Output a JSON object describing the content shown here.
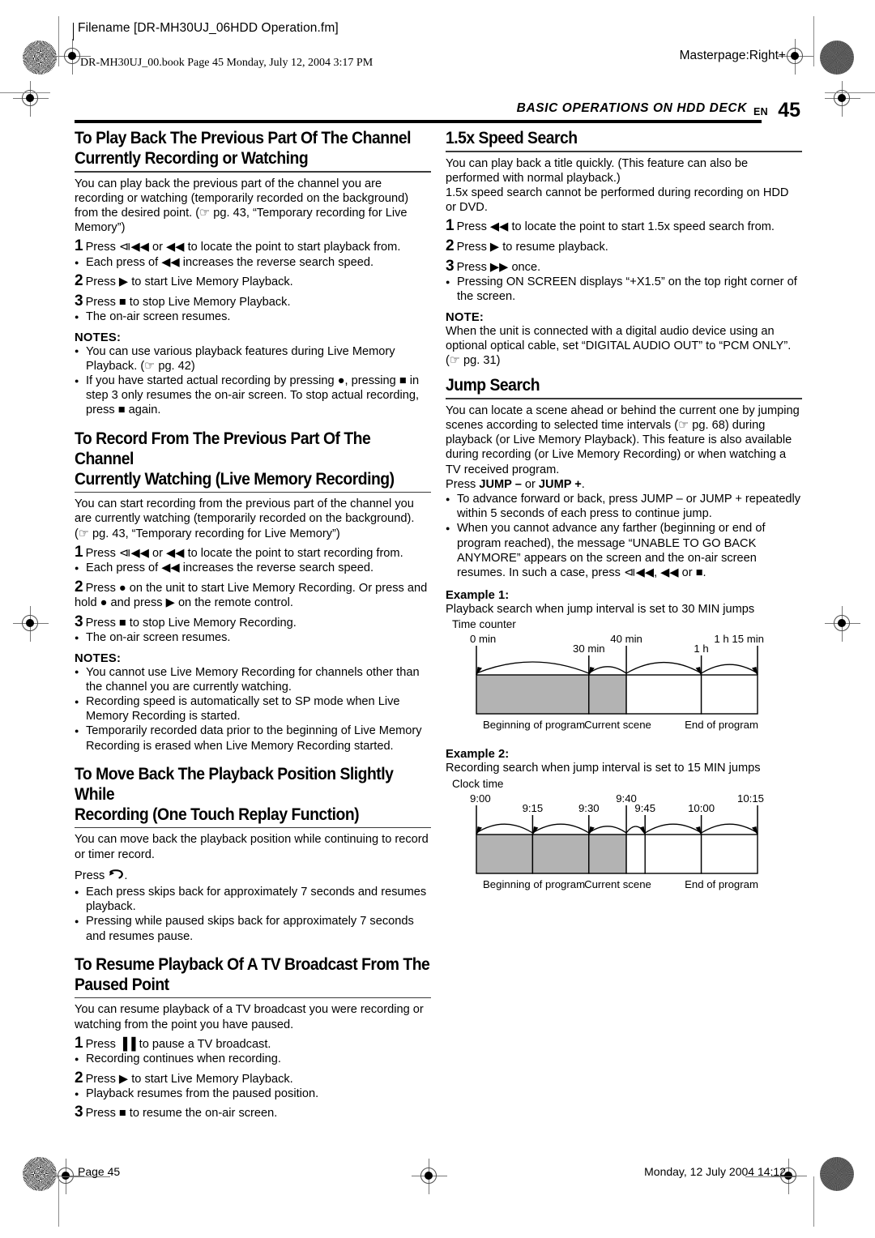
{
  "framemaker": {
    "filename_line": "Filename [DR-MH30UJ_06HDD Operation.fm]",
    "book_line": "DR-MH30UJ_00.book  Page 45  Monday, July 12, 2004  3:17 PM",
    "masterpage": "Masterpage:Right+"
  },
  "header": {
    "running_head": "BASIC OPERATIONS ON HDD DECK",
    "en_label": "EN",
    "page_number": "45"
  },
  "left_column": {
    "section1": {
      "heading_line1": "To Play Back The Previous Part Of The Channel",
      "heading_line2": "Currently Recording or Watching",
      "intro": "You can play back the previous part of the channel you are recording or watching (temporarily recorded on the background) from the desired point. (☞ pg. 43, “Temporary recording for Live Memory”)",
      "steps": [
        {
          "num": "1",
          "text": "Press ⧏◀◀ or ◀◀ to locate the point to start playback from."
        },
        {
          "num": "2",
          "text": "Press ▶ to start Live Memory Playback."
        },
        {
          "num": "3",
          "text": "Press ■ to stop Live Memory Playback."
        }
      ],
      "bullet_after_step1": "Each press of ◀◀ increases the reverse search speed.",
      "bullet_after_step3": "The on-air screen resumes.",
      "notes_label": "NOTES:",
      "notes": [
        "You can use various playback features during Live Memory Playback. (☞ pg. 42)",
        "If you have started actual recording by pressing ●, pressing ■ in step 3 only resumes the on-air screen. To stop actual recording, press ■ again."
      ]
    },
    "section2": {
      "heading_line1": "To Record From The Previous Part Of The Channel",
      "heading_line2": "Currently Watching (Live Memory Recording)",
      "intro": "You can start recording from the previous part of the channel you are currently watching (temporarily recorded on the background). (☞ pg. 43, “Temporary recording for Live Memory”)",
      "steps": [
        {
          "num": "1",
          "text": "Press ⧏◀◀ or ◀◀ to locate the point to start recording from."
        },
        {
          "num": "2",
          "text": "Press ● on the unit to start Live Memory Recording. Or press and hold ● and press ▶ on the remote control."
        },
        {
          "num": "3",
          "text": "Press ■ to stop Live Memory Recording."
        }
      ],
      "bullet_after_step1": "Each press of ◀◀ increases the reverse search speed.",
      "bullet_after_step3": "The on-air screen resumes.",
      "notes_label": "NOTES:",
      "notes": [
        "You cannot use Live Memory Recording for channels other than the channel you are currently watching.",
        "Recording speed is automatically set to SP mode when Live Memory Recording is started.",
        "Temporarily recorded data prior to the beginning of Live Memory Recording is erased when Live Memory Recording started."
      ]
    },
    "section3": {
      "heading_line1": "To Move Back The Playback Position Slightly While",
      "heading_line2": "Recording (One Touch Replay Function)",
      "intro": "You can move back the playback position while continuing to record or timer record.",
      "press_line": "Press",
      "press_suffix": ".",
      "bullets": [
        "Each press skips back for approximately 7 seconds and resumes playback.",
        "Pressing while paused skips back for approximately 7 seconds and resumes pause."
      ]
    },
    "section4": {
      "heading_line1": "To Resume Playback Of A TV Broadcast From The",
      "heading_line2": "Paused Point",
      "intro": "You can resume playback of a TV broadcast you were recording or watching from the point you have paused.",
      "steps": [
        {
          "num": "1",
          "text": "Press ▐▐ to pause a TV broadcast."
        },
        {
          "num": "2",
          "text": "Press ▶ to start Live Memory Playback."
        },
        {
          "num": "3",
          "text": "Press ■ to resume the on-air screen."
        }
      ],
      "bullet_after_step1": "Recording continues when recording.",
      "bullet_after_step2": "Playback resumes from the paused position."
    }
  },
  "right_column": {
    "section1": {
      "heading": "1.5x Speed Search",
      "intro1": "You can play back a title quickly. (This feature can also be performed with normal playback.)",
      "intro2": "1.5x speed search cannot be performed during recording on HDD or DVD.",
      "steps": [
        {
          "num": "1",
          "text": "Press ◀◀ to locate the point to start 1.5x speed search from."
        },
        {
          "num": "2",
          "text": "Press ▶ to resume playback."
        },
        {
          "num": "3",
          "text": "Press ▶▶ once."
        }
      ],
      "bullet": "Pressing ON SCREEN displays “+X1.5” on the top right corner of the screen.",
      "bullet_bold": "ON SCREEN",
      "note_label": "NOTE:",
      "note": "When the unit is connected with a digital audio device using an optional optical cable, set “DIGITAL AUDIO OUT” to “PCM ONLY”. (☞ pg. 31)"
    },
    "section2": {
      "heading": "Jump Search",
      "intro": "You can locate a scene ahead or behind the current one by jumping scenes according to selected time intervals (☞ pg. 68) during playback (or Live Memory Playback). This feature is also available during recording (or Live Memory Recording) or when watching a TV received program.",
      "press_line_prefix": "Press ",
      "press_line_bold1": "JUMP –",
      "press_line_mid": " or ",
      "press_line_bold2": "JUMP +",
      "press_line_suffix": ".",
      "bullets": [
        "To advance forward or back, press JUMP – or JUMP + repeatedly within 5 seconds of each press to continue jump.",
        "When you cannot advance any farther (beginning or end of program reached), the message “UNABLE TO GO BACK ANYMORE” appears on the screen and the on-air screen resumes. In such a case, press ⧏◀◀, ◀◀ or ■."
      ]
    },
    "example1": {
      "label": "Example 1:",
      "caption": "Playback search when jump interval is set to 30 MIN jumps",
      "axis_title": "Time counter",
      "footers": [
        "Beginning of program",
        "Current scene",
        "End of program"
      ]
    },
    "example2": {
      "label": "Example 2:",
      "caption": "Recording search when jump interval is set to 15 MIN jumps",
      "axis_title": "Clock time",
      "footers": [
        "Beginning of program",
        "Current scene",
        "End of program"
      ]
    }
  },
  "chart_data": [
    {
      "type": "timeline",
      "id": "example1",
      "title": "Playback search when jump interval is set to 30 MIN jumps",
      "axis_label": "Time counter",
      "unit": "minutes",
      "range": [
        0,
        75
      ],
      "ticks": [
        {
          "value": 0,
          "label": "0 min",
          "label_row": "top"
        },
        {
          "value": 30,
          "label": "30 min",
          "label_row": "bottom"
        },
        {
          "value": 40,
          "label": "40 min",
          "label_row": "top"
        },
        {
          "value": 60,
          "label": "1 h",
          "label_row": "bottom"
        },
        {
          "value": 75,
          "label": "1 h 15 min",
          "label_row": "top"
        }
      ],
      "shaded_segments": [
        [
          0,
          30
        ],
        [
          30,
          40
        ]
      ],
      "unshaded_segments": [
        [
          40,
          60
        ],
        [
          60,
          75
        ]
      ],
      "jump_arcs": [
        {
          "from": 30,
          "to": 0,
          "direction": "back"
        },
        {
          "from": 40,
          "to": 30,
          "direction": "back"
        },
        {
          "from": 40,
          "to": 60,
          "direction": "forward"
        },
        {
          "from": 60,
          "to": 75,
          "direction": "forward"
        }
      ],
      "footers": [
        "Beginning of program",
        "Current scene",
        "End of program"
      ],
      "current_scene_at": 40
    },
    {
      "type": "timeline",
      "id": "example2",
      "title": "Recording search when jump interval is set to 15 MIN jumps",
      "axis_label": "Clock time",
      "unit": "clock",
      "range": [
        0,
        75
      ],
      "ticks": [
        {
          "value": 0,
          "label": "9:00",
          "label_row": "top"
        },
        {
          "value": 15,
          "label": "9:15",
          "label_row": "bottom"
        },
        {
          "value": 30,
          "label": "9:30",
          "label_row": "bottom"
        },
        {
          "value": 40,
          "label": "9:40",
          "label_row": "top"
        },
        {
          "value": 45,
          "label": "9:45",
          "label_row": "bottom"
        },
        {
          "value": 60,
          "label": "10:00",
          "label_row": "bottom"
        },
        {
          "value": 75,
          "label": "10:15",
          "label_row": "top"
        }
      ],
      "shaded_segments": [
        [
          0,
          15
        ],
        [
          15,
          30
        ],
        [
          30,
          40
        ]
      ],
      "unshaded_segments": [
        [
          40,
          45
        ],
        [
          45,
          60
        ],
        [
          60,
          75
        ]
      ],
      "jump_arcs": [
        {
          "from": 15,
          "to": 0,
          "direction": "back"
        },
        {
          "from": 30,
          "to": 15,
          "direction": "back"
        },
        {
          "from": 40,
          "to": 30,
          "direction": "back"
        },
        {
          "from": 40,
          "to": 45,
          "direction": "forward"
        },
        {
          "from": 45,
          "to": 60,
          "direction": "forward"
        },
        {
          "from": 60,
          "to": 75,
          "direction": "forward"
        }
      ],
      "footers": [
        "Beginning of program",
        "Current scene",
        "End of program"
      ],
      "current_scene_at": 40
    }
  ],
  "footer": {
    "left": "Page 45",
    "right": "Monday, 12 July 2004  14:12"
  },
  "colors": {
    "shade": "#b3b3b3",
    "ink": "#000000",
    "rule": "#3b3b3b"
  }
}
